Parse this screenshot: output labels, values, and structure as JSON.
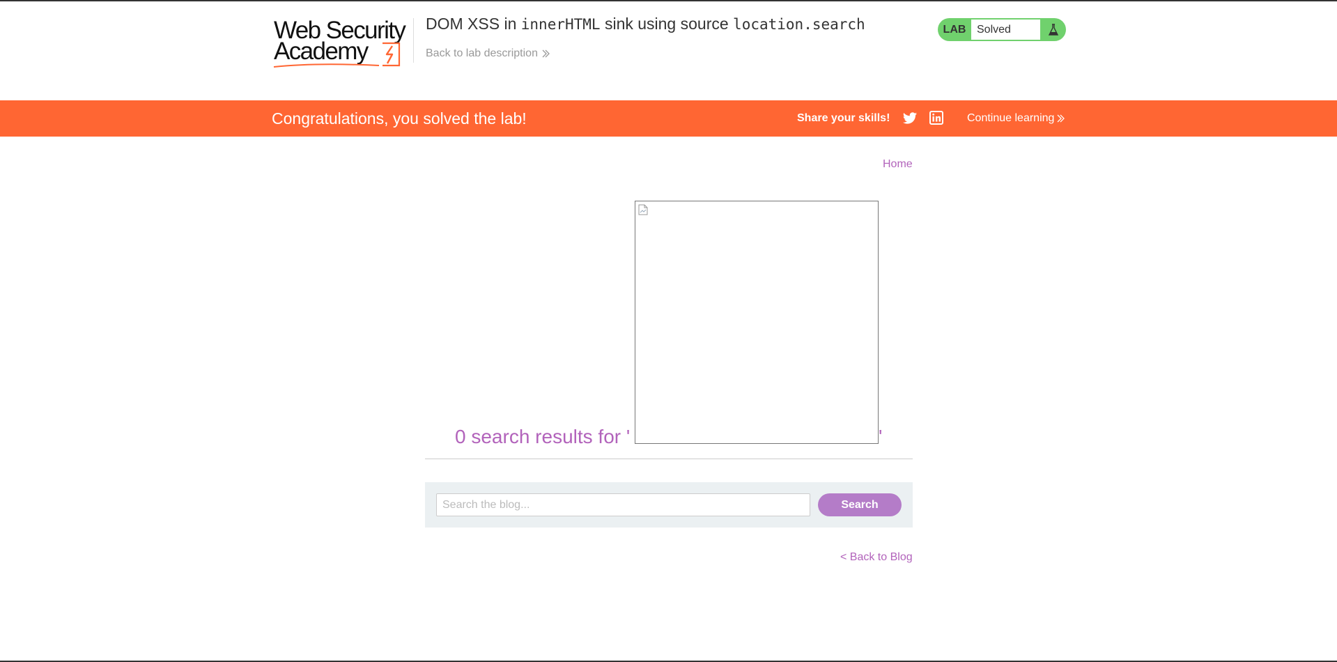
{
  "header": {
    "logo_line1": "Web Security",
    "logo_line2": "Academy",
    "lab_title_prefix": "DOM XSS in ",
    "lab_title_code1": "innerHTML",
    "lab_title_mid": " sink using source ",
    "lab_title_code2": "location.search",
    "back_to_description": "Back to lab description"
  },
  "lab_status": {
    "label": "LAB",
    "status": "Solved",
    "color": "#70d16d"
  },
  "banner": {
    "message": "Congratulations, you solved the lab!",
    "share_label": "Share your skills!",
    "continue_learning": "Continue learning",
    "color": "#ff6633"
  },
  "nav": {
    "home": "Home"
  },
  "results": {
    "heading": "0 search results for '",
    "heading_close": "'"
  },
  "search": {
    "placeholder": "Search the blog...",
    "button_label": "Search"
  },
  "footer_nav": {
    "back_to_blog": "< Back to Blog"
  },
  "colors": {
    "accent_purple": "#b263bb",
    "search_button": "#b47cc8"
  }
}
